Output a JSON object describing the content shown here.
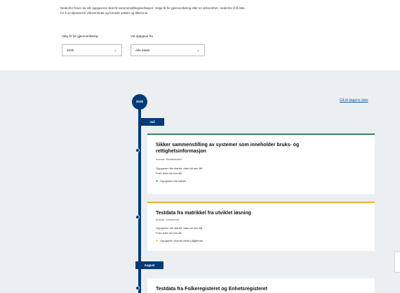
{
  "intro": {
    "line1": "Nedenfor finner du når oppgavene skal bli sammenstillingsverktøyet. Velge år for gjennomføring eller en virksomhet i nedenfor å få liste,",
    "line2": "for å se tilpasset til virksomheter og fornede avtaler og tilkomme."
  },
  "filters": {
    "year_label": "Velg år for gjennomføring",
    "year_value": "2025",
    "agency_label": "Vis oppgave fra",
    "agency_value": "Alle etater"
  },
  "timeline": {
    "year": "2025",
    "go_today": "Gå til dagens dato",
    "months": [
      {
        "label": "Juli"
      },
      {
        "label": "August"
      }
    ],
    "items": [
      {
        "title_line1": "Sikker sammenstilling av systemer som inneholder bruks- og",
        "title_line2": "rettighetsinformasjon",
        "agency": "Ansvar: Skatteetaten",
        "date1": "Oppgaven ble startet: dato dd.mm.åå",
        "date2": "Frist: dato dd.mm.åå",
        "status": "Oppgaven ble fullført",
        "status_mark": "●",
        "accent": "#2e8b57"
      },
      {
        "title_line1": "Testdata fra matrikkel fra utviklet løsning",
        "agency": "Ansvar: Kartverket",
        "date1": "Oppgaven ble startet: dato dd.mm.åå",
        "date2": "Frist: dato dd.mm.åå",
        "status": "Oppgaven skal bli utført pågående",
        "status_mark": "●",
        "accent": "#e8b62c"
      },
      {
        "title_line1": "Testdata fra Folkeregisteret og Enhetsregisteret"
      }
    ]
  },
  "colors": {
    "primary": "#003b78",
    "background": "#eceff1",
    "link": "#0b5fb0",
    "done": "#2e8b57",
    "pending": "#e8b62c"
  }
}
